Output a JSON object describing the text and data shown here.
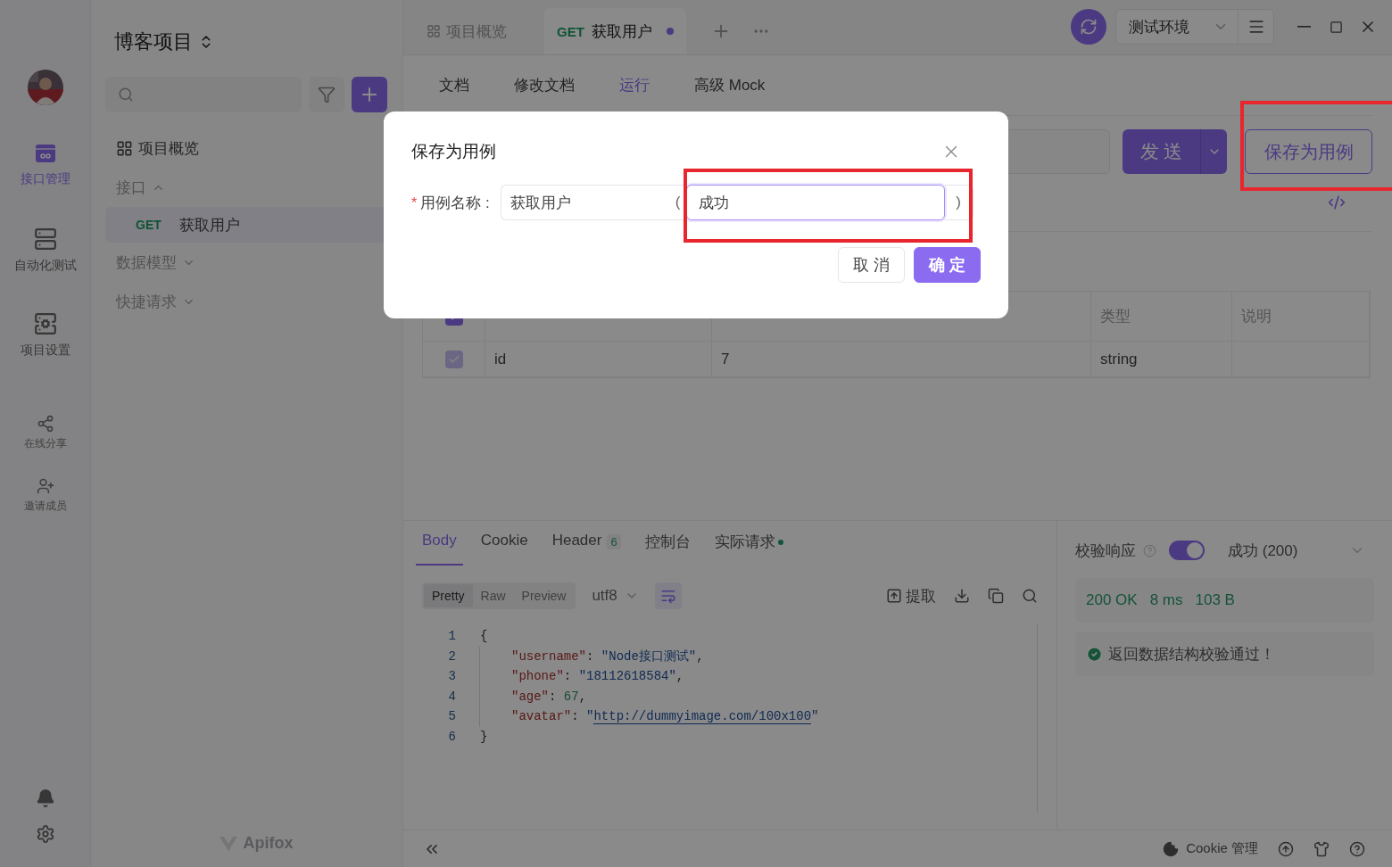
{
  "rail": {
    "items": [
      {
        "label": "接口管理",
        "kind": "api",
        "selected": true
      },
      {
        "label": "自动化测试",
        "kind": "automation",
        "selected": false
      },
      {
        "label": "项目设置",
        "kind": "settings",
        "selected": false
      }
    ],
    "secondary": [
      {
        "label": "在线分享",
        "kind": "share"
      },
      {
        "label": "邀请成员",
        "kind": "invite"
      }
    ]
  },
  "sidebar": {
    "project": "博客项目",
    "tree": [
      {
        "label": "项目概览",
        "kind": "link"
      },
      {
        "label": "接口",
        "kind": "folder",
        "expanded": true,
        "children": [
          {
            "method": "GET",
            "label": "获取用户",
            "selected": true
          }
        ]
      },
      {
        "label": "数据模型",
        "kind": "folder",
        "expanded": false
      },
      {
        "label": "快捷请求",
        "kind": "folder",
        "expanded": false
      }
    ],
    "brand": "Apifox"
  },
  "tabs": [
    {
      "label": "项目概览",
      "selected": false,
      "modified": false
    },
    {
      "method": "GET",
      "label": "获取用户",
      "selected": true,
      "modified": true
    }
  ],
  "environment": "测试环境",
  "doc_tabs": [
    {
      "label": "文档",
      "selected": false
    },
    {
      "label": "修改文档",
      "selected": false
    },
    {
      "label": "运行",
      "selected": true
    },
    {
      "label": "高级 Mock",
      "selected": false
    }
  ],
  "send_button": "发 送",
  "save_case_button": {
    "label": "保存为用例",
    "highlighted": true
  },
  "params_table": {
    "all_checked": true,
    "columns": [
      "",
      "",
      "类型",
      "说明"
    ],
    "rows": [
      {
        "checked": true,
        "cells": [
          "id",
          "7",
          "string"
        ]
      }
    ]
  },
  "response": {
    "tabs": [
      {
        "label": "Body",
        "selected": true,
        "dot": false
      },
      {
        "label": "Cookie",
        "selected": false,
        "dot": false
      },
      {
        "label": "Header",
        "count": "6",
        "selected": false,
        "dot": false
      },
      {
        "label": "控制台",
        "selected": false,
        "dot": false
      },
      {
        "label": "实际请求",
        "selected": false,
        "dot": true
      }
    ],
    "view_modes": [
      {
        "label": "Pretty",
        "selected": true
      },
      {
        "label": "Raw",
        "selected": false
      },
      {
        "label": "Preview",
        "selected": false
      }
    ],
    "encoding": "utf8",
    "extract": "提取",
    "lines": [
      {
        "number": "1",
        "indented": false,
        "tokens": [
          {
            "kind": "punct",
            "text": "{"
          }
        ]
      },
      {
        "number": "2",
        "indented": true,
        "tokens": [
          {
            "kind": "key",
            "text": "\"username\""
          },
          {
            "kind": "punct",
            "text": ": "
          },
          {
            "kind": "string",
            "text": "\"Node接口测试\""
          },
          {
            "kind": "punct",
            "text": ","
          }
        ]
      },
      {
        "number": "3",
        "indented": true,
        "tokens": [
          {
            "kind": "key",
            "text": "\"phone\""
          },
          {
            "kind": "punct",
            "text": ": "
          },
          {
            "kind": "string",
            "text": "\"18112618584\""
          },
          {
            "kind": "punct",
            "text": ","
          }
        ]
      },
      {
        "number": "4",
        "indented": true,
        "tokens": [
          {
            "kind": "key",
            "text": "\"age\""
          },
          {
            "kind": "punct",
            "text": ": "
          },
          {
            "kind": "number",
            "text": "67"
          },
          {
            "kind": "punct",
            "text": ","
          }
        ]
      },
      {
        "number": "5",
        "indented": true,
        "tokens": [
          {
            "kind": "key",
            "text": "\"avatar\""
          },
          {
            "kind": "punct",
            "text": ": "
          },
          {
            "kind": "string",
            "text": "\""
          },
          {
            "kind": "link",
            "text": "http://dummyimage.com/100x100"
          },
          {
            "kind": "string",
            "text": "\""
          }
        ]
      },
      {
        "number": "6",
        "indented": false,
        "tokens": [
          {
            "kind": "punct",
            "text": "}"
          }
        ]
      }
    ]
  },
  "validation": {
    "label": "校验响应",
    "enabled": true,
    "result": "成功 (200)",
    "status": "200 OK",
    "time": "8 ms",
    "size": "103 B",
    "message": "返回数据结构校验通过！"
  },
  "status_bar": {
    "cookie": "Cookie 管理"
  },
  "dialog": {
    "title": "保存为用例",
    "required_mark": "*",
    "field_label": "用例名称 :",
    "name_value": "获取用户",
    "open_paren": "(",
    "suffix_value": "成功",
    "suffix_focused": true,
    "suffix_highlighted": true,
    "close_paren": ")",
    "buttons": [
      {
        "label": "取 消",
        "kind": "default"
      },
      {
        "label": "确 定",
        "kind": "primary"
      }
    ]
  }
}
